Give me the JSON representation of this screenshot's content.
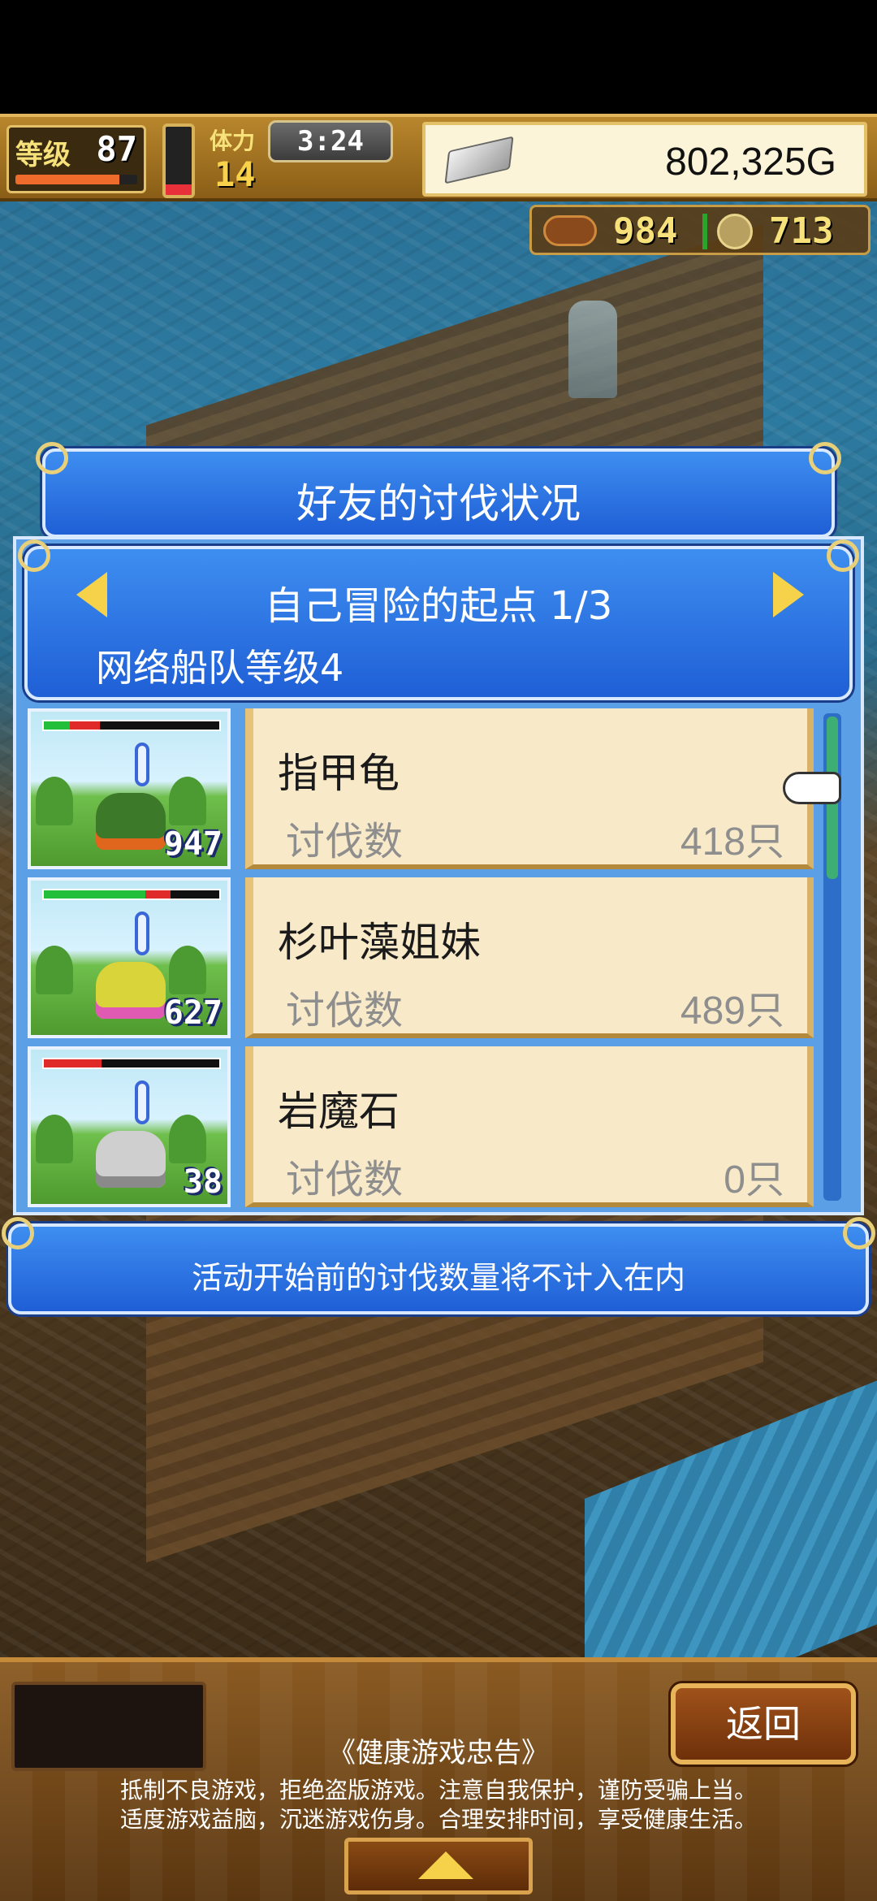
{
  "hud": {
    "level_label": "等级",
    "level_value": "87",
    "level_progress": 0.85,
    "stamina_fill": 0.15,
    "stamina_label": "体力",
    "stamina_value": "14",
    "timer": "3:24",
    "gold": "802,325G",
    "meat_value": "984",
    "coin_value": "713"
  },
  "dialog": {
    "title": "好友的讨伐状况",
    "stage": "自己冒险的起点 1/3",
    "fleet_level": "网络船队等级4",
    "kills_label": "讨伐数",
    "monsters": [
      {
        "name": "指甲龟",
        "kills": "418只",
        "level": "947",
        "hp_green": 0.15,
        "hp_red": 0.17,
        "color": "#3c7a2a",
        "accent": "#e0661e"
      },
      {
        "name": "杉叶藻姐妹",
        "kills": "489只",
        "level": "627",
        "hp_green": 0.58,
        "hp_red": 0.14,
        "color": "#d8d43a",
        "accent": "#e05ab4"
      },
      {
        "name": "岩魔石",
        "kills": "0只",
        "level": "38",
        "hp_green": 0.0,
        "hp_red": 0.33,
        "color": "#cfcfcf",
        "accent": "#8a8a8a"
      }
    ],
    "notice": "活动开始前的讨伐数量将不计入在内"
  },
  "bottom": {
    "back_label": "返回",
    "advisory_title": "《健康游戏忠告》",
    "advisory_line1": "抵制不良游戏，拒绝盗版游戏。注意自我保护，谨防受骗上当。",
    "advisory_line2": "适度游戏益脑，沉迷游戏伤身。合理安排时间，享受健康生活。"
  },
  "icons": {
    "ingot": "silver-ingot-icon",
    "meat": "meat-icon",
    "coin": "medal-coin-icon",
    "hand": "pointing-hand-icon",
    "left": "arrow-left-icon",
    "right": "arrow-right-icon",
    "up": "up-arrow-icon"
  }
}
